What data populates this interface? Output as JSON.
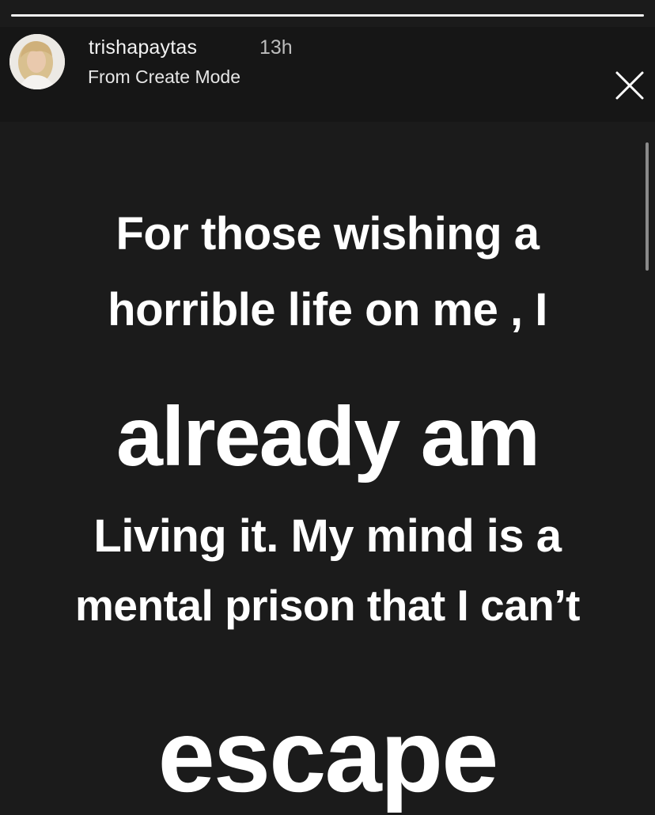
{
  "story": {
    "progress": 1.0,
    "username": "trishapaytas",
    "timestamp": "13h",
    "subtitle": "From Create Mode",
    "close_icon": "close-icon",
    "lines": [
      "For those wishing a",
      "horrible life on me , I",
      "already am",
      "Living it. My mind is a",
      "mental prison that I can’t",
      "escape"
    ]
  }
}
